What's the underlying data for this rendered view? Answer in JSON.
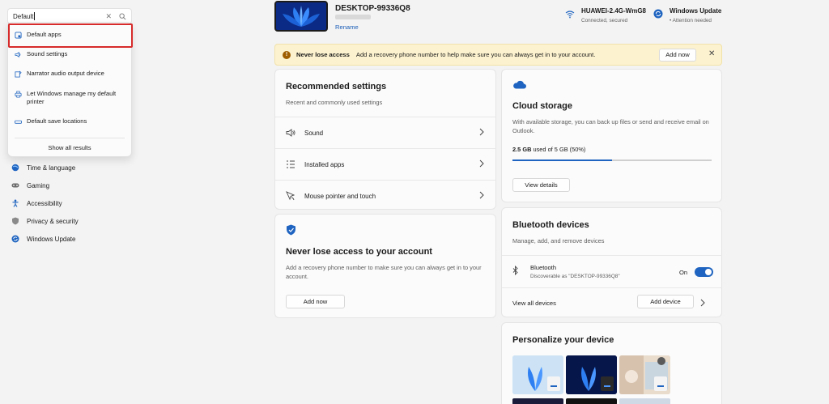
{
  "search": {
    "value": "Default"
  },
  "dropdown": {
    "items": [
      {
        "label": "Default apps"
      },
      {
        "label": "Sound settings"
      },
      {
        "label": "Narrator audio output device"
      },
      {
        "label": "Let Windows manage my default printer"
      },
      {
        "label": "Default save locations"
      }
    ],
    "show_all": "Show all results"
  },
  "nav": {
    "items": [
      {
        "label": "Time & language",
        "icon": "globe-clock-icon"
      },
      {
        "label": "Gaming",
        "icon": "gamepad-icon"
      },
      {
        "label": "Accessibility",
        "icon": "accessibility-icon"
      },
      {
        "label": "Privacy & security",
        "icon": "shield-icon"
      },
      {
        "label": "Windows Update",
        "icon": "windows-update-icon"
      }
    ]
  },
  "header": {
    "device_name": "DESKTOP-99336Q8",
    "rename": "Rename",
    "wifi": {
      "name": "HUAWEI-2.4G-WmG8",
      "status": "Connected, secured"
    },
    "update": {
      "name": "Windows Update",
      "status": "• Attention needed"
    }
  },
  "banner": {
    "title": "Never lose access",
    "text": "Add a recovery phone number to help make sure you can always get in to your account.",
    "button": "Add now"
  },
  "recommended": {
    "title": "Recommended settings",
    "subtitle": "Recent and commonly used settings",
    "rows": [
      {
        "label": "Sound",
        "icon": "speaker-icon"
      },
      {
        "label": "Installed apps",
        "icon": "list-icon"
      },
      {
        "label": "Mouse pointer and touch",
        "icon": "mouse-pointer-icon"
      }
    ]
  },
  "account": {
    "title": "Never lose access to your account",
    "text": "Add a recovery phone number to make sure you can always get in to your account.",
    "button": "Add now"
  },
  "cloud": {
    "title": "Cloud storage",
    "text": "With available storage, you can back up files or send and receive email on Outlook.",
    "used": "2.5 GB",
    "used_rest": "used of 5 GB (50%)",
    "percent": 50,
    "button": "View details"
  },
  "bluetooth": {
    "title": "Bluetooth devices",
    "subtitle": "Manage, add, and remove devices",
    "device": "Bluetooth",
    "discoverable": "Discoverable as \"DESKTOP-99336Q8\"",
    "state": "On",
    "view_all": "View all devices",
    "add": "Add device"
  },
  "personalize": {
    "title": "Personalize your device"
  },
  "colors": {
    "accent": "#1f64c0",
    "highlight": "#d72b2b",
    "banner": "#fcf2cf"
  }
}
